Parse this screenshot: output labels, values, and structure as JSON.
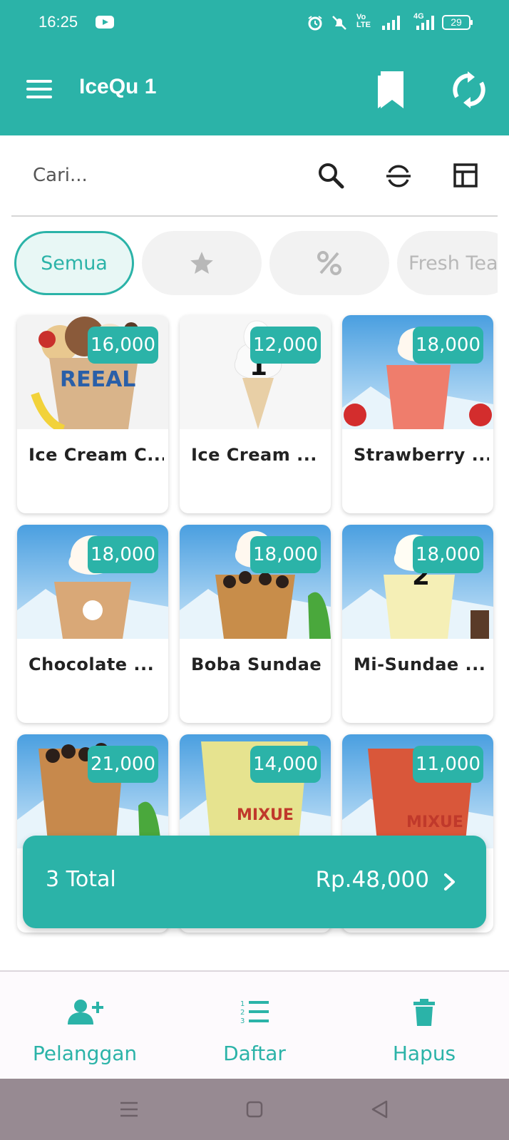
{
  "status_bar": {
    "time": "16:25",
    "volte_label": "Vo LTE",
    "network_label": "4G",
    "battery": "29"
  },
  "app_bar": {
    "title": "IceQu 1",
    "menu_icon": "menu-icon",
    "actions": [
      "bookmark-icon",
      "sync-icon"
    ]
  },
  "search": {
    "placeholder": "Cari...",
    "icons": [
      "search-icon",
      "scan-icon",
      "layout-icon"
    ]
  },
  "categories": [
    {
      "label": "Semua",
      "active": true
    },
    {
      "icon": "star-icon",
      "active": false
    },
    {
      "icon": "percent-icon",
      "active": false
    },
    {
      "label": "Fresh Tea",
      "active": false
    }
  ],
  "products": [
    {
      "name": "Ice Cream C...",
      "price": "16,000",
      "qty": ""
    },
    {
      "name": "Ice Cream ...",
      "price": "12,000",
      "qty": "1"
    },
    {
      "name": "Strawberry ...",
      "price": "18,000",
      "qty": ""
    },
    {
      "name": "Chocolate ...",
      "price": "18,000",
      "qty": ""
    },
    {
      "name": "Boba Sundae",
      "price": "18,000",
      "qty": ""
    },
    {
      "name": "Mi-Sundae ...",
      "price": "18,000",
      "qty": "2"
    },
    {
      "name": "",
      "price": "21,000",
      "qty": ""
    },
    {
      "name": "",
      "price": "14,000",
      "qty": ""
    },
    {
      "name": "",
      "price": "11,000",
      "qty": ""
    }
  ],
  "total_bar": {
    "count_label": "3 Total",
    "amount": "Rp.48,000"
  },
  "bottom_nav": [
    {
      "label": "Pelanggan",
      "icon": "add-user-icon"
    },
    {
      "label": "Daftar",
      "icon": "numbered-list-icon"
    },
    {
      "label": "Hapus",
      "icon": "trash-icon"
    }
  ],
  "colors": {
    "primary": "#2bb3a8",
    "chip_inactive": "#f2f2f2",
    "system_nav": "#978a92"
  }
}
